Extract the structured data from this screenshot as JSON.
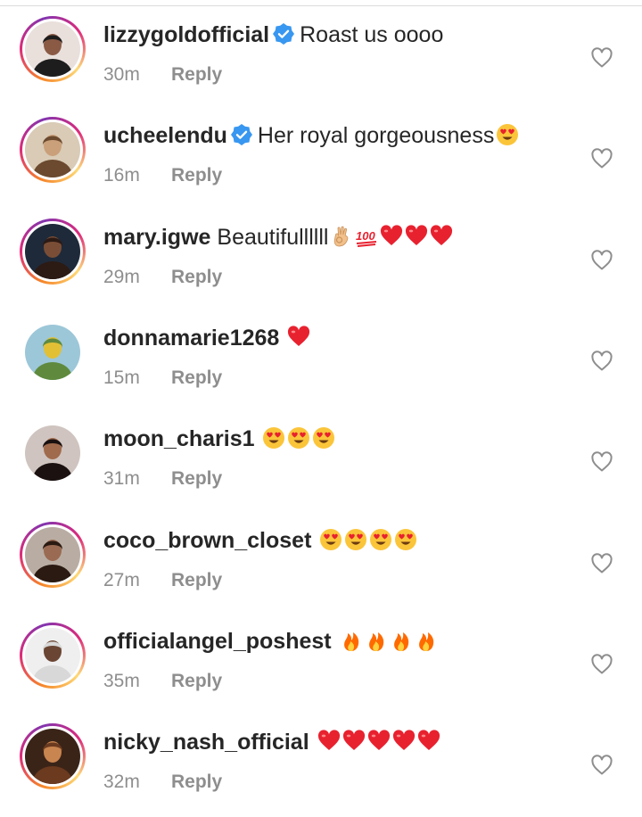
{
  "colors": {
    "text": "#262626",
    "secondary": "#8e8e8e",
    "verified": "#3897f0",
    "heart": "#ed4956",
    "fire": "#ff6a00"
  },
  "comments": [
    {
      "username": "lizzygoldofficial",
      "verified": true,
      "text": "Roast us oooo",
      "time": "30m",
      "reply": "Reply",
      "emojis": []
    },
    {
      "username": "ucheelendu",
      "verified": true,
      "text": "Her royal gorgeousness",
      "time": "16m",
      "reply": "Reply",
      "emojis": [
        "heart-eyes"
      ]
    },
    {
      "username": "mary.igwe",
      "verified": false,
      "text": "Beautifullllll",
      "time": "29m",
      "reply": "Reply",
      "emojis": [
        "ok-hand",
        "hundred",
        "red-heart",
        "red-heart",
        "red-heart"
      ]
    },
    {
      "username": "donnamarie1268",
      "verified": false,
      "text": "",
      "time": "15m",
      "reply": "Reply",
      "emojis": [
        "red-heart"
      ]
    },
    {
      "username": "moon_charis1",
      "verified": false,
      "text": "",
      "time": "31m",
      "reply": "Reply",
      "emojis": [
        "heart-eyes",
        "heart-eyes",
        "heart-eyes"
      ]
    },
    {
      "username": "coco_brown_closet",
      "verified": false,
      "text": "",
      "time": "27m",
      "reply": "Reply",
      "emojis": [
        "heart-eyes",
        "heart-eyes",
        "heart-eyes",
        "heart-eyes"
      ]
    },
    {
      "username": "officialangel_poshest",
      "verified": false,
      "text": "",
      "time": "35m",
      "reply": "Reply",
      "emojis": [
        "fire",
        "fire",
        "fire",
        "fire"
      ]
    },
    {
      "username": "nicky_nash_official",
      "verified": false,
      "text": "",
      "time": "32m",
      "reply": "Reply",
      "emojis": [
        "red-heart",
        "red-heart",
        "red-heart",
        "red-heart",
        "red-heart"
      ]
    }
  ]
}
